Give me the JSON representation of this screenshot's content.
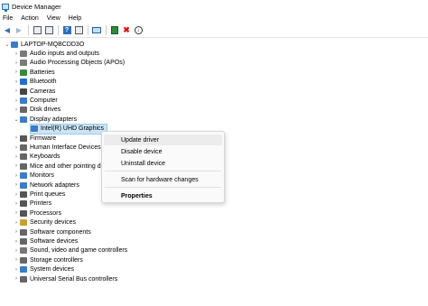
{
  "window": {
    "title": "Device Manager"
  },
  "menu": [
    "File",
    "Action",
    "View",
    "Help"
  ],
  "toolbar": [
    {
      "name": "back-arrow-icon"
    },
    {
      "name": "forward-arrow-icon"
    },
    {
      "name": "properties-icon"
    },
    {
      "name": "show-hidden-icon"
    },
    {
      "name": "help-icon"
    },
    {
      "name": "scan-icon"
    },
    {
      "name": "monitor-icon"
    },
    {
      "name": "update-driver-icon"
    },
    {
      "name": "uninstall-x-icon"
    },
    {
      "name": "download-circle-icon"
    }
  ],
  "tree": {
    "root": "LAPTOP-MQBCDD3O",
    "categories": [
      {
        "label": "Audio inputs and outputs",
        "icon_color": "#7a7a7a"
      },
      {
        "label": "Audio Processing Objects (APOs)",
        "icon_color": "#7a7a7a"
      },
      {
        "label": "Batteries",
        "icon_color": "#3a8a3a"
      },
      {
        "label": "Bluetooth",
        "icon_color": "#1e6fd0"
      },
      {
        "label": "Cameras",
        "icon_color": "#444444"
      },
      {
        "label": "Computer",
        "icon_color": "#3b7bc8"
      },
      {
        "label": "Disk drives",
        "icon_color": "#666666"
      },
      {
        "label": "Display adapters",
        "icon_color": "#3b7bc8"
      },
      {
        "label": "Firmware",
        "icon_color": "#555555"
      },
      {
        "label": "Human Interface Devices",
        "icon_color": "#666666"
      },
      {
        "label": "Keyboards",
        "icon_color": "#666666"
      },
      {
        "label": "Mice and other pointing devices",
        "icon_color": "#666666"
      },
      {
        "label": "Monitors",
        "icon_color": "#3b7bc8"
      },
      {
        "label": "Network adapters",
        "icon_color": "#3b7bc8"
      },
      {
        "label": "Print queues",
        "icon_color": "#555555"
      },
      {
        "label": "Printers",
        "icon_color": "#555555"
      },
      {
        "label": "Processors",
        "icon_color": "#555555"
      },
      {
        "label": "Security devices",
        "icon_color": "#c8a030"
      },
      {
        "label": "Software components",
        "icon_color": "#666666"
      },
      {
        "label": "Software devices",
        "icon_color": "#666666"
      },
      {
        "label": "Sound, video and game controllers",
        "icon_color": "#777777"
      },
      {
        "label": "Storage controllers",
        "icon_color": "#666666"
      },
      {
        "label": "System devices",
        "icon_color": "#3b7bc8"
      },
      {
        "label": "Universal Serial Bus controllers",
        "icon_color": "#666666"
      }
    ],
    "expanded_child": "Intel(R) UHD Graphics"
  },
  "context_menu": {
    "items": [
      "Update driver",
      "Disable device",
      "Uninstall device",
      "Scan for hardware changes",
      "Properties"
    ]
  }
}
